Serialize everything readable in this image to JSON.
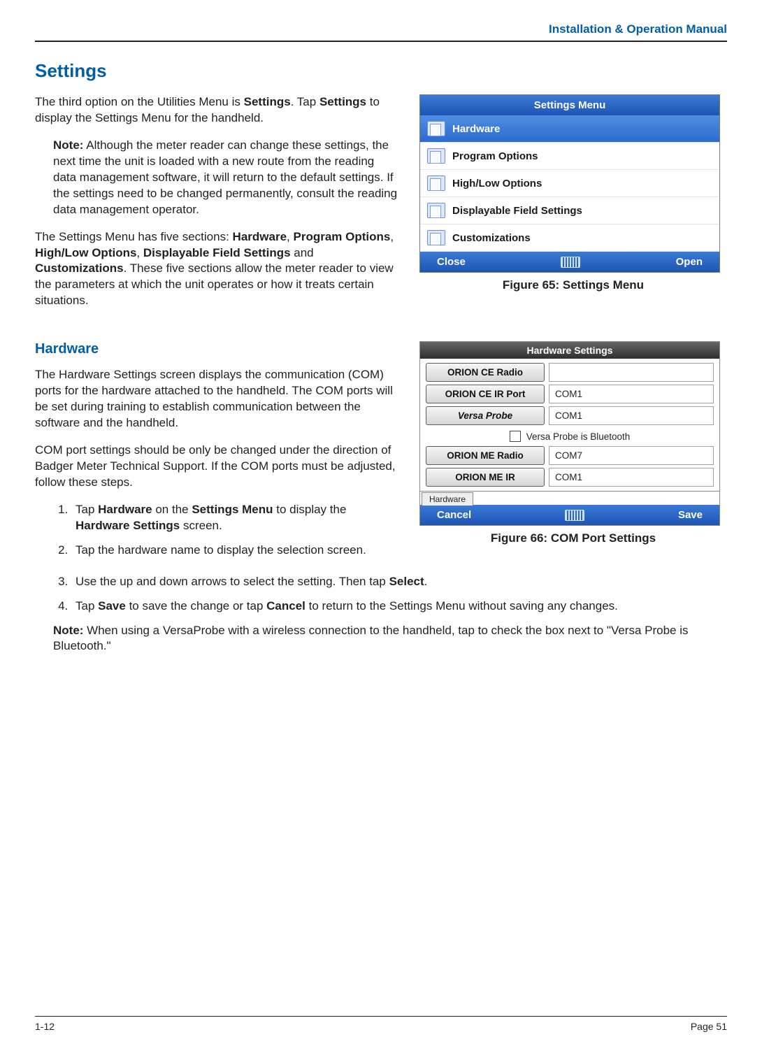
{
  "header": {
    "title": "Installation & Operation Manual"
  },
  "section": {
    "title": "Settings"
  },
  "intro": {
    "p1_a": "The third option on the Utilities Menu is ",
    "p1_b": "Settings",
    "p1_c": ". Tap ",
    "p1_d": "Settings",
    "p1_e": " to display the Settings Menu for the handheld.",
    "note_label": "Note:",
    "note_body": " Although the meter reader can change these settings, the next time the unit is loaded with a new route from the reading data management software, it will return to the default settings. If the settings need to be changed permanently, consult the reading data management operator.",
    "p2_a": "The Settings Menu has five sections: ",
    "p2_b": "Hardware",
    "p2_c": ", ",
    "p2_d": "Program Options",
    "p2_e": ", ",
    "p2_f": "High/Low Options",
    "p2_g": ", ",
    "p2_h": "Displayable Field Settings",
    "p2_i": " and ",
    "p2_j": "Customizations",
    "p2_k": ". These five sections allow the meter reader to view the parameters at which the unit operates or how it treats certain situations."
  },
  "figure65": {
    "caption": "Figure 65:  Settings Menu",
    "title": "Settings Menu",
    "items": [
      "Hardware",
      "Program Options",
      "High/Low Options",
      "Displayable Field Settings",
      "Customizations"
    ],
    "soft_left": "Close",
    "soft_right": "Open"
  },
  "hardware": {
    "title": "Hardware",
    "p1": "The Hardware Settings screen displays the communication (COM) ports for the hardware attached to the handheld. The COM ports will be set during training to establish communication between the software and the handheld.",
    "p2": "COM port settings should be only be changed under the direction of Badger Meter Technical Support. If the COM ports must be adjusted, follow these steps.",
    "step1_a": "Tap ",
    "step1_b": "Hardware",
    "step1_c": " on the ",
    "step1_d": "Settings Menu",
    "step1_e": " to display the ",
    "step1_f": "Hardware Settings",
    "step1_g": " screen.",
    "step2": "Tap the hardware name to display the selection screen.",
    "step3_a": "Use the up and down arrows to select the setting. Then tap ",
    "step3_b": "Select",
    "step3_c": ".",
    "step4_a": "Tap ",
    "step4_b": "Save",
    "step4_c": " to save the change or tap ",
    "step4_d": "Cancel",
    "step4_e": " to return to the Settings Menu without saving any changes.",
    "note_label": "Note:",
    "note_body": " When using a VersaProbe with a wireless connection to the handheld, tap to check the box next to \"Versa Probe is Bluetooth.\""
  },
  "figure66": {
    "caption": "Figure 66:  COM Port Settings",
    "title": "Hardware Settings",
    "rows": [
      {
        "label": "ORION CE Radio",
        "value": ""
      },
      {
        "label": "ORION CE IR Port",
        "value": "COM1"
      },
      {
        "label": "Versa Probe",
        "value": "COM1"
      }
    ],
    "checkbox_label": "Versa Probe is Bluetooth",
    "rows2": [
      {
        "label": "ORION ME Radio",
        "value": "COM7"
      },
      {
        "label": "ORION ME IR",
        "value": "COM1"
      }
    ],
    "tab": "Hardware",
    "soft_left": "Cancel",
    "soft_right": "Save"
  },
  "footer": {
    "left": "1-12",
    "right": "Page 51"
  }
}
